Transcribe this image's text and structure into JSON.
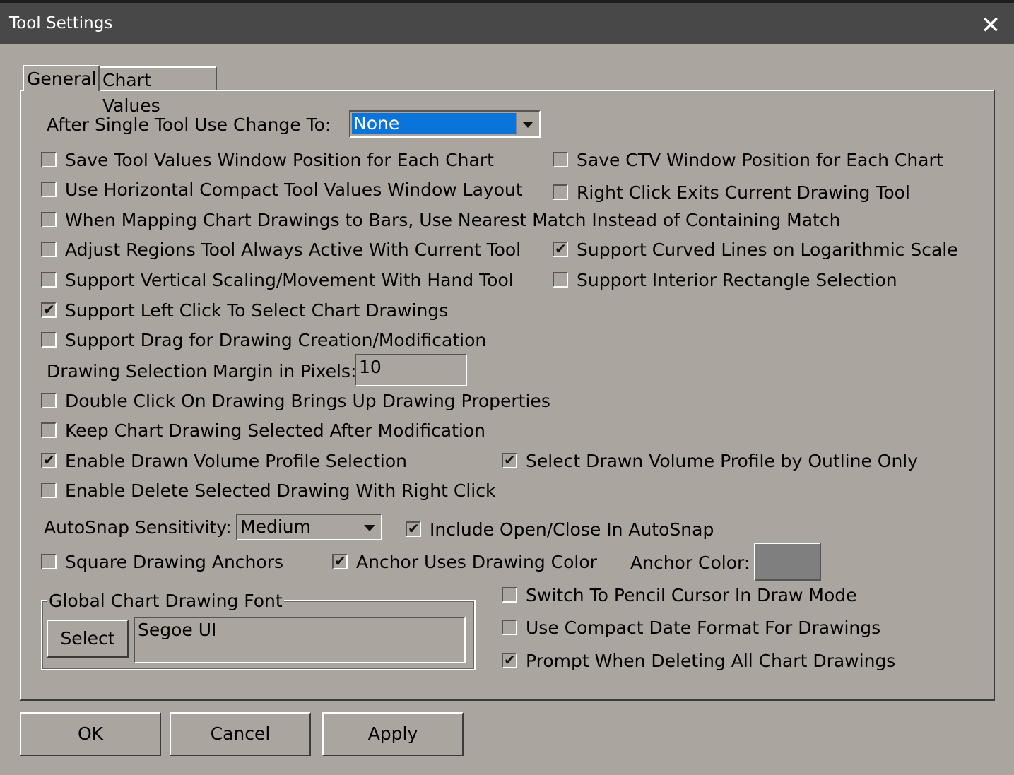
{
  "window": {
    "title": "Tool Settings",
    "close_icon": "close-icon"
  },
  "tabs": [
    {
      "label": "General"
    },
    {
      "label": "Chart Values"
    }
  ],
  "after_single_tool": {
    "label": "After Single Tool Use Change To:",
    "value": "None"
  },
  "checkboxes": {
    "save_tool_values_pos": {
      "label": "Save Tool Values Window Position for Each Chart",
      "checked": false
    },
    "save_ctv_pos": {
      "label": "Save CTV Window Position for Each Chart",
      "checked": false
    },
    "horizontal_compact": {
      "label": "Use Horizontal Compact Tool Values Window Layout",
      "checked": false
    },
    "right_click_exits": {
      "label": "Right Click Exits Current Drawing Tool",
      "checked": false
    },
    "nearest_match": {
      "label": "When Mapping Chart Drawings to Bars, Use Nearest Match Instead of Containing Match",
      "checked": false
    },
    "adjust_regions": {
      "label": "Adjust Regions Tool Always Active With Current Tool",
      "checked": false
    },
    "curved_lines_log": {
      "label": "Support Curved Lines on Logarithmic Scale",
      "checked": true
    },
    "vertical_scaling": {
      "label": "Support Vertical Scaling/Movement With Hand Tool",
      "checked": false
    },
    "interior_rect": {
      "label": "Support Interior Rectangle Selection",
      "checked": false
    },
    "left_click_select": {
      "label": "Support Left Click To Select Chart Drawings",
      "checked": true
    },
    "drag_creation": {
      "label": "Support Drag for Drawing Creation/Modification",
      "checked": false
    },
    "double_click_props": {
      "label": "Double Click On Drawing Brings Up Drawing Properties",
      "checked": false
    },
    "keep_selected": {
      "label": "Keep Chart Drawing Selected After Modification",
      "checked": false
    },
    "enable_vp_selection": {
      "label": "Enable Drawn Volume Profile Selection",
      "checked": true
    },
    "vp_outline_only": {
      "label": "Select Drawn Volume Profile by Outline Only",
      "checked": true
    },
    "delete_right_click": {
      "label": "Enable Delete Selected Drawing With Right Click",
      "checked": false
    },
    "include_open_close": {
      "label": "Include Open/Close In AutoSnap",
      "checked": true
    },
    "square_anchors": {
      "label": "Square Drawing Anchors",
      "checked": false
    },
    "anchor_uses_color": {
      "label": "Anchor Uses Drawing Color",
      "checked": true
    },
    "pencil_cursor": {
      "label": "Switch To Pencil Cursor In Draw Mode",
      "checked": false
    },
    "compact_date": {
      "label": "Use Compact Date Format For Drawings",
      "checked": false
    },
    "prompt_delete_all": {
      "label": "Prompt When Deleting All Chart Drawings",
      "checked": true
    }
  },
  "selection_margin": {
    "label": "Drawing Selection Margin in Pixels:",
    "value": "10"
  },
  "autosnap": {
    "label": "AutoSnap Sensitivity:",
    "value": "Medium"
  },
  "anchor_color": {
    "label": "Anchor Color:",
    "color": "#7f7f7f"
  },
  "font_group": {
    "label": "Global Chart Drawing Font",
    "select_label": "Select",
    "font_value": "Segoe UI"
  },
  "buttons": {
    "ok": "OK",
    "cancel": "Cancel",
    "apply": "Apply"
  },
  "check_glyph": "✔"
}
